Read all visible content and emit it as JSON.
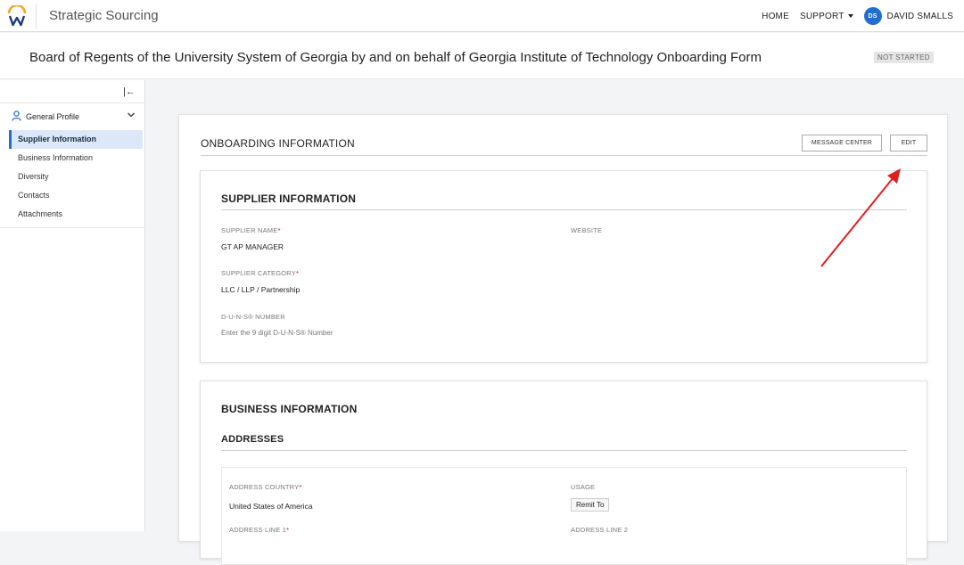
{
  "header": {
    "app_title": "Strategic Sourcing",
    "nav": {
      "home": "HOME",
      "support": "SUPPORT",
      "avatar_initials": "DS",
      "user_name": "DAVID SMALLS"
    }
  },
  "form": {
    "title": "Board of Regents of the University System of Georgia by and on behalf of Georgia Institute of Technology Onboarding Form",
    "status": "NOT STARTED"
  },
  "sidebar": {
    "group_label": "General Profile",
    "items": [
      {
        "label": "Supplier Information"
      },
      {
        "label": "Business Information"
      },
      {
        "label": "Diversity"
      },
      {
        "label": "Contacts"
      },
      {
        "label": "Attachments"
      }
    ]
  },
  "main": {
    "title": "ONBOARDING INFORMATION",
    "message_center_label": "MESSAGE CENTER",
    "edit_label": "EDIT"
  },
  "supplier_section": {
    "title": "SUPPLIER INFORMATION",
    "supplier_name_label": "SUPPLIER NAME",
    "supplier_name_value": "GT AP MANAGER",
    "website_label": "WEBSITE",
    "category_label": "SUPPLIER CATEGORY",
    "category_value": "LLC / LLP / Partnership",
    "duns_label": "D-U-N-S® NUMBER",
    "duns_placeholder": "Enter the 9 digit D-U-N-S® Number"
  },
  "business_section": {
    "title": "BUSINESS INFORMATION",
    "subtitle": "ADDRESSES",
    "country_label": "ADDRESS COUNTRY",
    "country_value": "United States of America",
    "usage_label": "USAGE",
    "usage_value": "Remit To",
    "line1_label": "ADDRESS LINE 1",
    "line2_label": "ADDRESS LINE 2"
  },
  "colors": {
    "accent": "#1f6fd1",
    "required": "#d0021b",
    "annotation_arrow": "#e02020"
  }
}
